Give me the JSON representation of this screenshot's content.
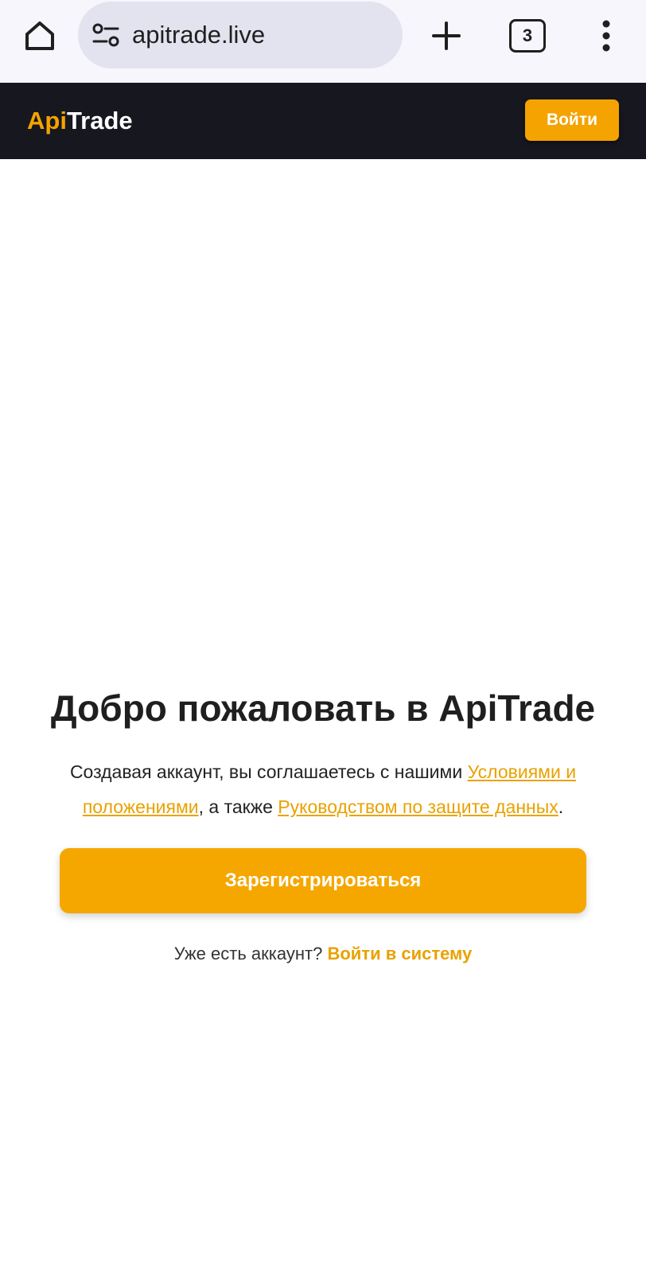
{
  "browser": {
    "url": "apitrade.live",
    "tab_count": "3",
    "icons": {
      "home": "home-icon",
      "site_settings": "tune-icon",
      "new_tab": "plus-icon",
      "menu": "more-vert-icon"
    }
  },
  "header": {
    "logo_accent": "Api",
    "logo_main": "Trade",
    "login_label": "Войти"
  },
  "welcome": {
    "title": "Добро пожаловать в ApiTrade",
    "consent_prefix": "Создавая аккаунт, вы соглашаетесь с нашими ",
    "terms_link": "Условиями и положениями",
    "consent_middle": ", а также ",
    "privacy_link": "Руководством по защите данных",
    "consent_suffix": ".",
    "register_label": "Зарегистрироваться",
    "have_account_text": "Уже есть аккаунт? ",
    "login_link": "Войти в систему"
  },
  "colors": {
    "accent": "#f4a300",
    "header_bg": "#16171f",
    "browser_bg": "#f7f6fc",
    "url_pill_bg": "#e3e3f0"
  }
}
